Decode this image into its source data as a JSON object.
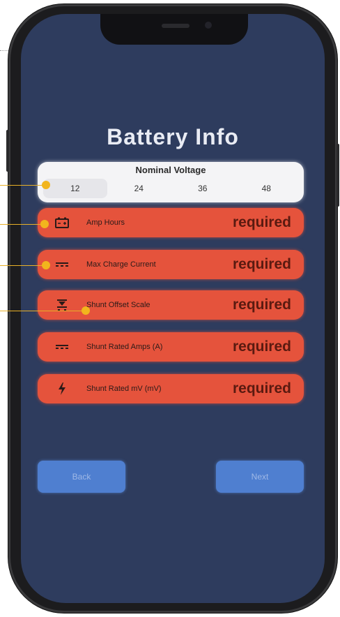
{
  "screen": {
    "title": "Battery Info",
    "nominal_voltage": {
      "label": "Nominal Voltage",
      "options": [
        "12",
        "24",
        "36",
        "48"
      ],
      "selected": "12"
    },
    "fields": [
      {
        "label": "Amp Hours",
        "status": "required",
        "icon": "battery-icon"
      },
      {
        "label": "Max Charge Current",
        "status": "required",
        "icon": "dc-current-icon"
      },
      {
        "label": "Shunt Offset Scale",
        "status": "required",
        "icon": "scale-icon"
      },
      {
        "label": "Shunt Rated Amps (A)",
        "status": "required",
        "icon": "dc-current-icon"
      },
      {
        "label": "Shunt Rated mV (mV)",
        "status": "required",
        "icon": "lightning-icon"
      }
    ],
    "buttons": {
      "back": "Back",
      "next": "Next"
    }
  },
  "colors": {
    "background": "#2e3c5e",
    "field_bg": "#e5533c",
    "button_bg": "#4f7fd0",
    "callout": "#f2b51d"
  }
}
